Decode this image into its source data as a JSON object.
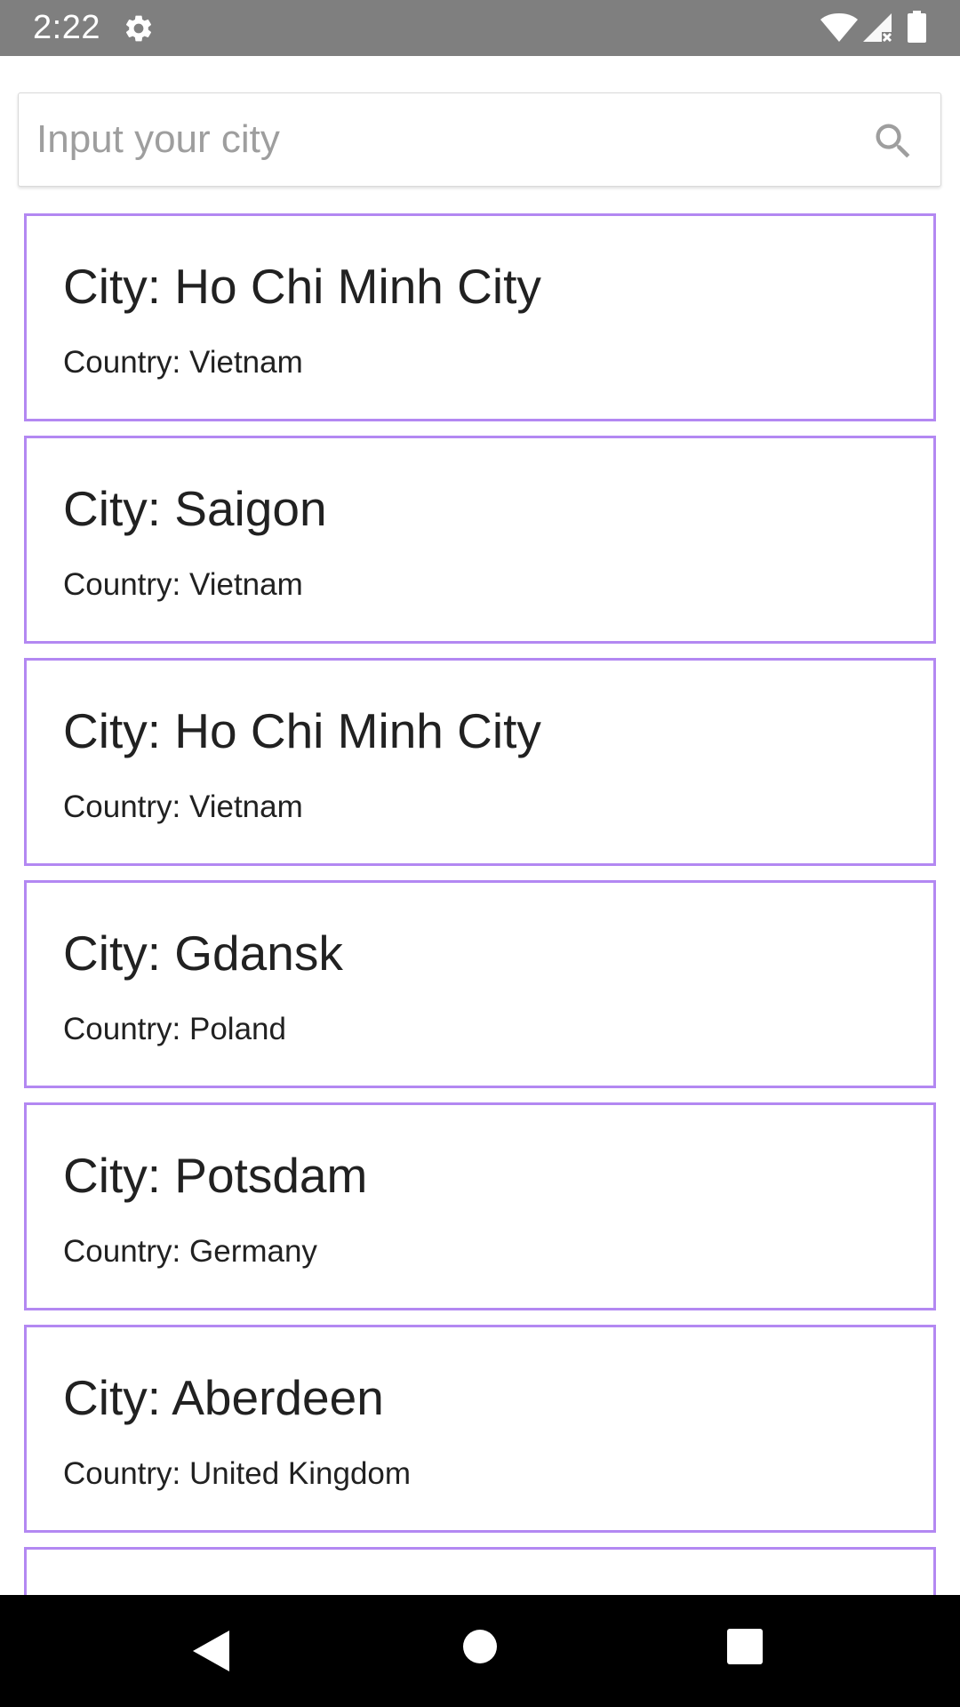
{
  "status_bar": {
    "time": "2:22",
    "icons": [
      "gear-icon",
      "wifi-icon",
      "cell-signal-icon",
      "battery-icon"
    ]
  },
  "search": {
    "placeholder": "Input your city",
    "value": "",
    "icon": "search-icon"
  },
  "cities": [
    {
      "city": "City: Ho Chi Minh City",
      "country": "Country: Vietnam"
    },
    {
      "city": "City: Saigon",
      "country": "Country: Vietnam"
    },
    {
      "city": "City: Ho Chi Minh City",
      "country": "Country: Vietnam"
    },
    {
      "city": "City: Gdansk",
      "country": "Country: Poland"
    },
    {
      "city": "City: Potsdam",
      "country": "Country: Germany"
    },
    {
      "city": "City: Aberdeen",
      "country": "Country: United Kingdom"
    },
    {
      "city": "",
      "country": ""
    }
  ],
  "nav_bar": {
    "icons": [
      "back-icon",
      "home-icon",
      "recents-icon"
    ]
  },
  "colors": {
    "status_bar": "#7f7f7f",
    "card_border": "#b388f2",
    "text": "#212121",
    "placeholder": "#9e9e9e",
    "nav_bar": "#000000"
  }
}
